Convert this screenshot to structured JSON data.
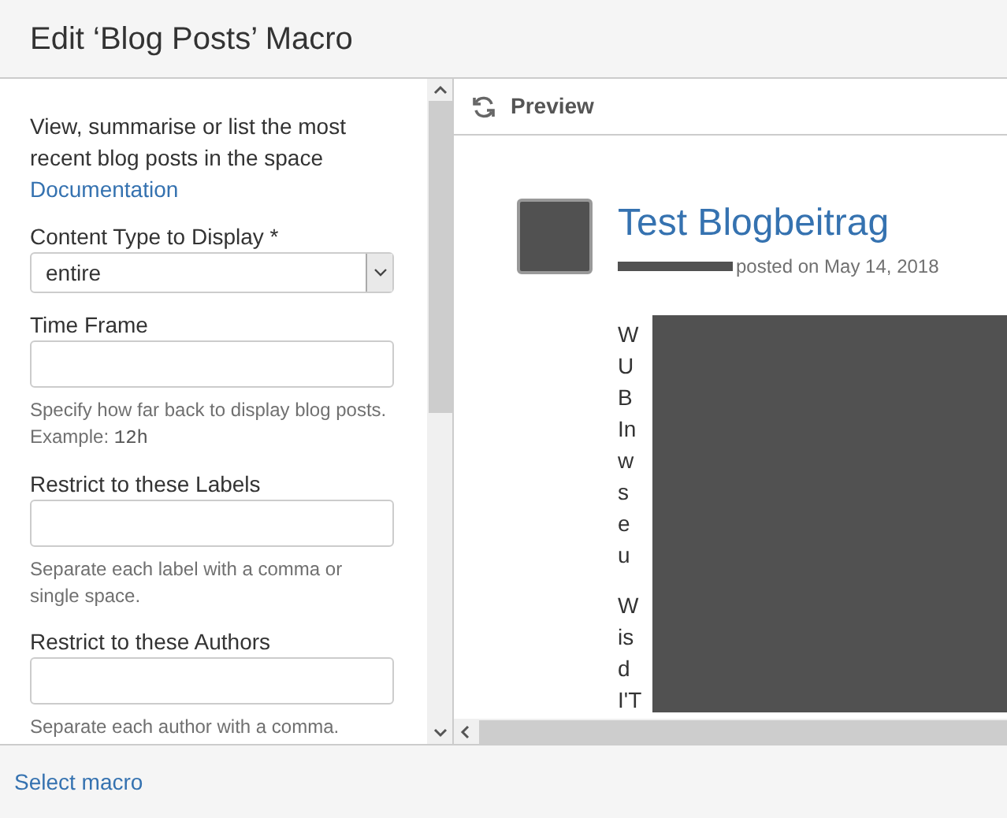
{
  "dialog": {
    "title": "Edit ‘Blog Posts’ Macro"
  },
  "description": "View, summarise or list the most recent blog posts in the space",
  "doc_link": "Documentation",
  "fields": [
    {
      "kind": "select",
      "label": "Content Type to Display *",
      "value": "entire"
    },
    {
      "kind": "text",
      "label": "Time Frame",
      "help": "Specify how far back to display blog posts. Example:",
      "help_code": "12h"
    },
    {
      "kind": "text",
      "label": "Restrict to these Labels",
      "help": "Separate each label with a comma or single space."
    },
    {
      "kind": "text",
      "label": "Restrict to these Authors",
      "help": "Separate each author with a comma."
    }
  ],
  "preview": {
    "heading": "Preview",
    "post_title": "Test Blogbeitrag",
    "meta": "posted on May 14, 2018",
    "paragraphs": [
      [
        "W",
        "U",
        "B",
        "In",
        "w",
        "s",
        "e",
        "u"
      ],
      [
        "W",
        "is",
        "d",
        "I'T"
      ]
    ]
  },
  "footer": {
    "link": "Select macro"
  }
}
